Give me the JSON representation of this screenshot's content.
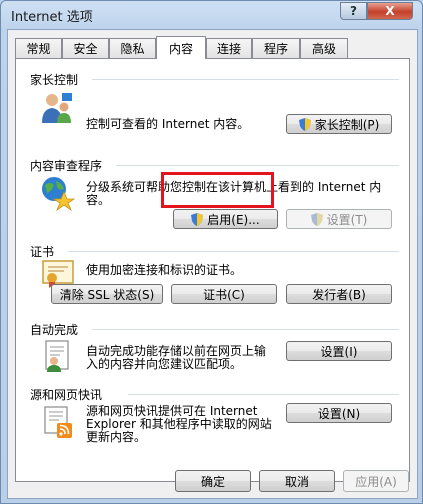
{
  "window": {
    "title": "Internet 选项",
    "help_label": "?",
    "close_label": "X"
  },
  "tabs": [
    "常规",
    "安全",
    "隐私",
    "内容",
    "连接",
    "程序",
    "高级"
  ],
  "active_tab": "内容",
  "groups": {
    "parental": {
      "title": "家长控制",
      "desc": "控制可查看的 Internet 内容。",
      "button": "家长控制(P)"
    },
    "advisor": {
      "title": "内容审查程序",
      "desc_line1": "分级系统可帮助您控制在该计算机上看到的 Internet 内",
      "desc_line2": "容。",
      "enable_button": "启用(E)...",
      "settings_button": "设置(T)"
    },
    "certificates": {
      "title": "证书",
      "desc": "使用加密连接和标识的证书。",
      "clear_ssl_button": "清除 SSL 状态(S)",
      "certs_button": "证书(C)",
      "publishers_button": "发行者(B)"
    },
    "autocomplete": {
      "title": "自动完成",
      "desc_line1": "自动完成功能存储以前在网页上输",
      "desc_line2": "入的内容并向您建议匹配项。",
      "settings_button": "设置(I)"
    },
    "feeds": {
      "title": "源和网页快讯",
      "desc_line1": "源和网页快讯提供可在 Internet",
      "desc_line2": "Explorer 和其他程序中读取的网站",
      "desc_line3": "更新内容。",
      "settings_button": "设置(N)"
    }
  },
  "footer": {
    "ok": "确定",
    "cancel": "取消",
    "apply": "应用(A)"
  },
  "colors": {
    "highlight": "#e3141d",
    "title_bar": "#bcd3ec"
  }
}
